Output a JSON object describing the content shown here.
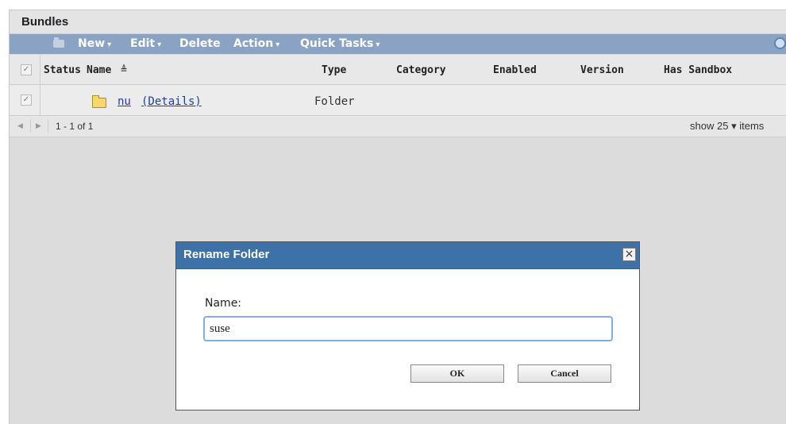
{
  "panel": {
    "title": "Bundles"
  },
  "toolbar": {
    "new": "New",
    "edit": "Edit",
    "delete": "Delete",
    "action": "Action",
    "quick_tasks": "Quick Tasks"
  },
  "table": {
    "columns": [
      "Status",
      "Name",
      "Type",
      "Category",
      "Enabled",
      "Version",
      "Has Sandbox"
    ],
    "sort_indicator": "≜",
    "rows": [
      {
        "name": "nu",
        "details": "(Details)",
        "type": "Folder",
        "checked": true
      }
    ]
  },
  "pager": {
    "count": "1 - 1 of 1",
    "show_prefix": "show",
    "page_size": "25",
    "suffix": "items"
  },
  "dialog": {
    "title": "Rename Folder",
    "close": "×",
    "label": "Name:",
    "value": "suse",
    "ok": "OK",
    "cancel": "Cancel"
  },
  "icons": {
    "folder": "folder-icon",
    "refresh": "refresh-icon",
    "new": "new-folder-icon",
    "caret": "▾",
    "check": "✓",
    "prev": "◀",
    "next": "▶"
  },
  "colors": {
    "toolbar": "#8aa3c4",
    "dialog_header": "#3c72a8",
    "link": "#1f3f9f",
    "input_border": "#82aee0"
  }
}
